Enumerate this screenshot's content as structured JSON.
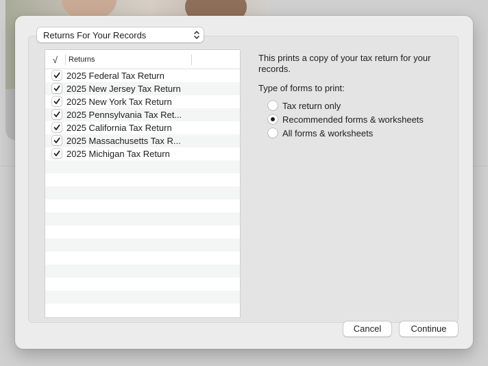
{
  "dialog": {
    "popup": {
      "selected": "Returns For Your Records"
    },
    "table": {
      "header_check": "√",
      "header_returns": "Returns",
      "rows": [
        {
          "label": "2025 Federal Tax Return",
          "checked": true
        },
        {
          "label": "2025 New Jersey Tax Return",
          "checked": true
        },
        {
          "label": "2025 New York Tax Return",
          "checked": true
        },
        {
          "label": "2025 Pennsylvania Tax Ret...",
          "checked": true
        },
        {
          "label": "2025 California Tax Return",
          "checked": true
        },
        {
          "label": "2025 Massachusetts Tax R...",
          "checked": true
        },
        {
          "label": "2025 Michigan Tax Return",
          "checked": true
        }
      ]
    },
    "description": "This prints a copy of your tax return for your records.",
    "forms_label": "Type of forms to print:",
    "radio_options": [
      {
        "label": "Tax return only",
        "selected": false
      },
      {
        "label": "Recommended forms & worksheets",
        "selected": true
      },
      {
        "label": "All forms & worksheets",
        "selected": false
      }
    ],
    "buttons": {
      "cancel": "Cancel",
      "continue": "Continue"
    }
  },
  "icons": {
    "popup": "chevron-up-down-icon",
    "checkbox": "checkmark-icon"
  }
}
